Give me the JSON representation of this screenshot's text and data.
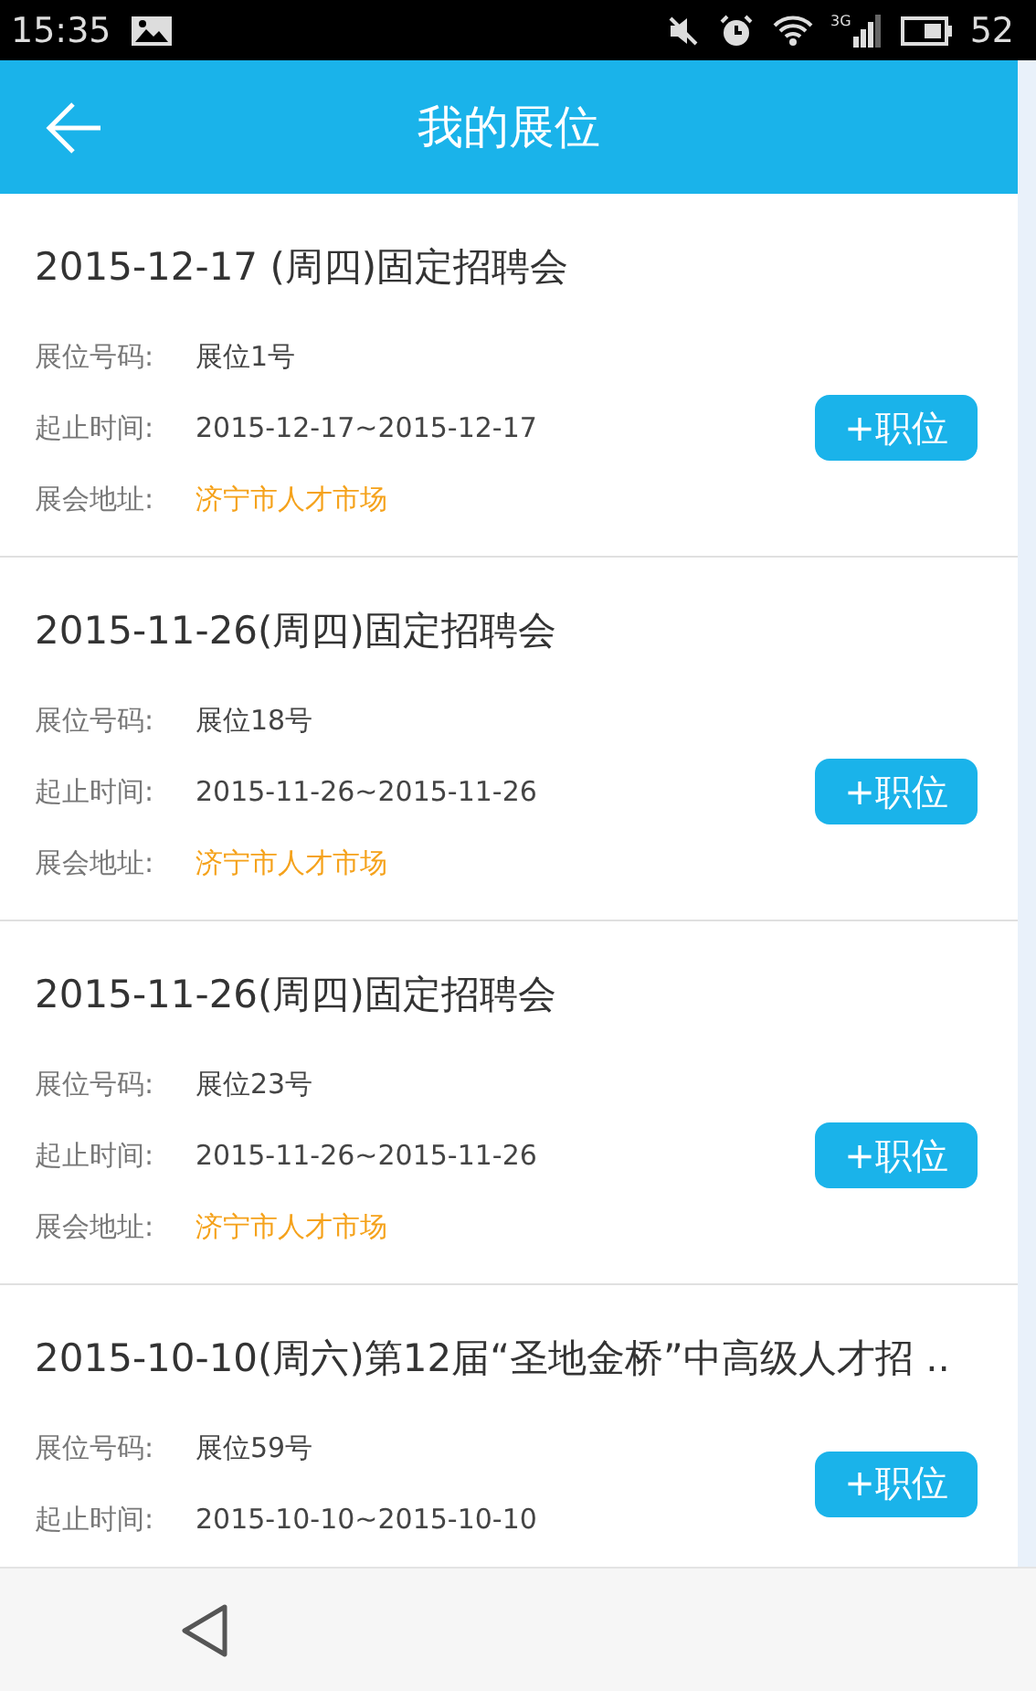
{
  "status_bar": {
    "time": "15:35",
    "network": "3G",
    "battery": "52"
  },
  "header": {
    "title": "我的展位"
  },
  "booths": [
    {
      "title": "2015-12-17 (周四)固定招聘会",
      "fields": [
        {
          "label": "展位号码:",
          "value": "展位1号",
          "kind": "plain"
        },
        {
          "label": "起止时间:",
          "value": "2015-12-17~2015-12-17",
          "kind": "plain"
        },
        {
          "label": "展会地址:",
          "value": "济宁市人才市场",
          "kind": "link"
        }
      ],
      "button": "+职位"
    },
    {
      "title": "2015-11-26(周四)固定招聘会",
      "fields": [
        {
          "label": "展位号码:",
          "value": "展位18号",
          "kind": "plain"
        },
        {
          "label": "起止时间:",
          "value": "2015-11-26~2015-11-26",
          "kind": "plain"
        },
        {
          "label": "展会地址:",
          "value": "济宁市人才市场",
          "kind": "link"
        }
      ],
      "button": "+职位"
    },
    {
      "title": "2015-11-26(周四)固定招聘会",
      "fields": [
        {
          "label": "展位号码:",
          "value": "展位23号",
          "kind": "plain"
        },
        {
          "label": "起止时间:",
          "value": "2015-11-26~2015-11-26",
          "kind": "plain"
        },
        {
          "label": "展会地址:",
          "value": "济宁市人才市场",
          "kind": "link"
        }
      ],
      "button": "+职位"
    },
    {
      "title": "2015-10-10(周六)第12届“圣地金桥”中高级人才招 ..",
      "fields": [
        {
          "label": "展位号码:",
          "value": "展位59号",
          "kind": "plain"
        },
        {
          "label": "起止时间:",
          "value": "2015-10-10~2015-10-10",
          "kind": "plain"
        }
      ],
      "button": "+职位"
    }
  ]
}
